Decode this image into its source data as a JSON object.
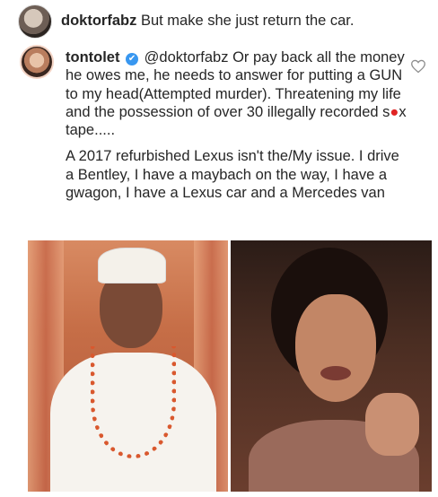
{
  "comment1": {
    "username": "doktorfabz",
    "text": "But make she just return the car."
  },
  "comment2": {
    "username": "tontolet",
    "mention": "@doktorfabz",
    "line_a_rest": "Or pay back all the money he owes me, he needs to answer for putting a GUN to my head(Attempted murder). Threatening my life and the possession of over 30 illegally recorded s",
    "censor_mark": "●",
    "line_a_end": "x tape.....",
    "paragraph2": "A 2017 refurbished Lexus isn't the/My issue. I drive a Bentley, I have a maybach on the way, I have a gwagon, I have a Lexus car and a Mercedes van",
    "verified_mark": "✔"
  },
  "watermark": "",
  "icons": {
    "like": "heart-outline-icon"
  },
  "colors": {
    "text": "#262626",
    "verified": "#3897f0",
    "censor": "#e02424"
  }
}
